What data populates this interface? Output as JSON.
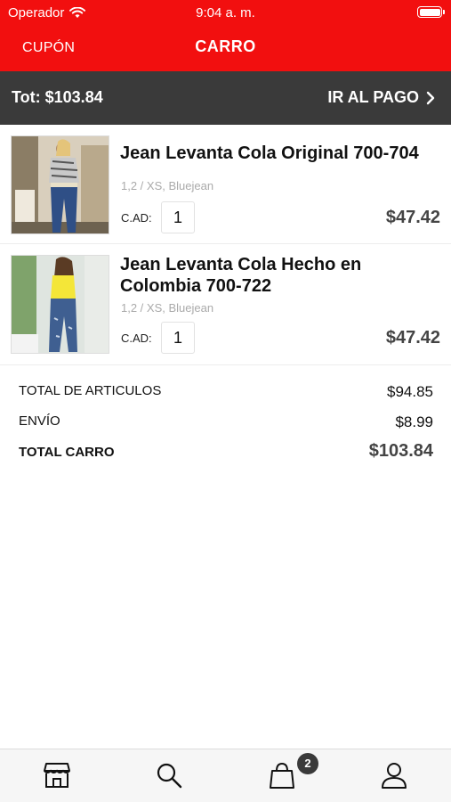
{
  "status_bar": {
    "carrier": "Operador",
    "time": "9:04 a. m."
  },
  "header": {
    "coupon_label": "CUPÓN",
    "title": "CARRO"
  },
  "checkout_bar": {
    "total_label": "Tot: $103.84",
    "pay_label": "IR AL PAGO"
  },
  "cart_items": [
    {
      "name": "Jean Levanta Cola Original 700-704",
      "variant": "1,2 / XS, Bluejean",
      "qty_label": "C.AD:",
      "quantity": "1",
      "price": "$47.42"
    },
    {
      "name": "Jean Levanta Cola Hecho en Colombia 700-722",
      "variant": "1,2 / XS, Bluejean",
      "qty_label": "C.AD:",
      "quantity": "1",
      "price": "$47.42"
    }
  ],
  "summary": {
    "items_label": "TOTAL DE ARTICULOS",
    "items_value": "$94.85",
    "shipping_label": "ENVÍO",
    "shipping_value": "$8.99",
    "total_label": "TOTAL CARRO",
    "total_value": "$103.84"
  },
  "tabbar": {
    "icons": [
      "store-icon",
      "search-icon",
      "shopping-bag-icon",
      "user-icon"
    ],
    "cart_badge": "2"
  },
  "colors": {
    "brand_red": "#f20f0f",
    "dark_bar": "#3a3a3a"
  }
}
